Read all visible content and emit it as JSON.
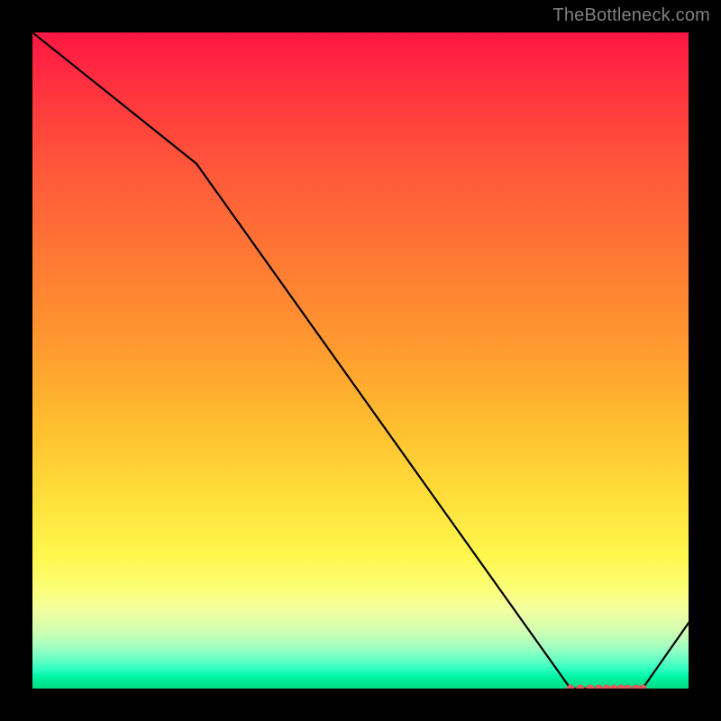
{
  "attribution": "TheBottleneck.com",
  "chart_data": {
    "type": "line",
    "title": "",
    "xlabel": "",
    "ylabel": "",
    "xlim": [
      0,
      100
    ],
    "ylim": [
      0,
      100
    ],
    "x": [
      0,
      25,
      82,
      85,
      88,
      90,
      93,
      100
    ],
    "values": [
      100,
      80,
      0,
      0,
      0,
      0,
      0,
      10
    ],
    "markers": {
      "x": [
        82,
        83.5,
        85,
        86.3,
        87.5,
        88.6,
        89.7,
        90.7,
        92,
        93
      ],
      "y": [
        0,
        0,
        0,
        0,
        0,
        0,
        0,
        0,
        0,
        0
      ]
    },
    "gradient_stops": [
      {
        "offset": 0,
        "color": "#ff1744"
      },
      {
        "offset": 0.12,
        "color": "#ff3d3d"
      },
      {
        "offset": 0.22,
        "color": "#ff5a3a"
      },
      {
        "offset": 0.35,
        "color": "#ff7a33"
      },
      {
        "offset": 0.48,
        "color": "#ff9a2f"
      },
      {
        "offset": 0.6,
        "color": "#ffbf2f"
      },
      {
        "offset": 0.72,
        "color": "#ffe23c"
      },
      {
        "offset": 0.8,
        "color": "#fff84f"
      },
      {
        "offset": 0.85,
        "color": "#fcff7a"
      },
      {
        "offset": 0.88,
        "color": "#f1ffa0"
      },
      {
        "offset": 0.91,
        "color": "#d4ffb0"
      },
      {
        "offset": 0.935,
        "color": "#a6ffc0"
      },
      {
        "offset": 0.955,
        "color": "#6affc5"
      },
      {
        "offset": 0.97,
        "color": "#2fffc0"
      },
      {
        "offset": 0.982,
        "color": "#00f5a6"
      },
      {
        "offset": 0.99,
        "color": "#00e893"
      },
      {
        "offset": 1.0,
        "color": "#00dd86"
      }
    ],
    "line_color": "#000000",
    "marker_color": "#e05a5a"
  }
}
